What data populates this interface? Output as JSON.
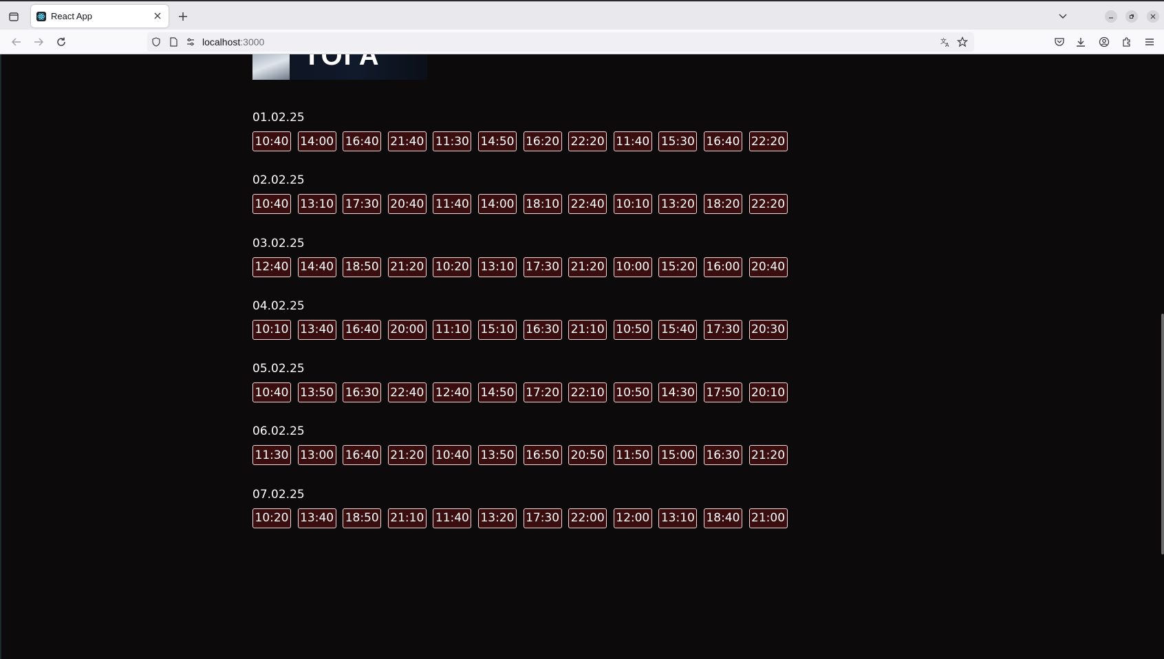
{
  "browser": {
    "tab_title": "React App",
    "url_host": "localhost",
    "url_port": ":3000"
  },
  "poster": {
    "title_fragment": "ТОГА"
  },
  "schedule": [
    {
      "date": "01.02.25",
      "times": [
        "10:40",
        "14:00",
        "16:40",
        "21:40",
        "11:30",
        "14:50",
        "16:20",
        "22:20",
        "11:40",
        "15:30",
        "16:40",
        "22:20"
      ]
    },
    {
      "date": "02.02.25",
      "times": [
        "10:40",
        "13:10",
        "17:30",
        "20:40",
        "11:40",
        "14:00",
        "18:10",
        "22:40",
        "10:10",
        "13:20",
        "18:20",
        "22:20"
      ]
    },
    {
      "date": "03.02.25",
      "times": [
        "12:40",
        "14:40",
        "18:50",
        "21:20",
        "10:20",
        "13:10",
        "17:30",
        "21:20",
        "10:00",
        "15:20",
        "16:00",
        "20:40"
      ]
    },
    {
      "date": "04.02.25",
      "times": [
        "10:10",
        "13:40",
        "16:40",
        "20:00",
        "11:10",
        "15:10",
        "16:30",
        "21:10",
        "10:50",
        "15:40",
        "17:30",
        "20:30"
      ]
    },
    {
      "date": "05.02.25",
      "times": [
        "10:40",
        "13:50",
        "16:30",
        "22:40",
        "12:40",
        "14:50",
        "17:20",
        "22:10",
        "10:50",
        "14:30",
        "17:50",
        "20:10"
      ]
    },
    {
      "date": "06.02.25",
      "times": [
        "11:30",
        "13:00",
        "16:40",
        "21:20",
        "10:40",
        "13:50",
        "16:50",
        "20:50",
        "11:50",
        "15:00",
        "16:30",
        "21:20"
      ]
    },
    {
      "date": "07.02.25",
      "times": [
        "10:20",
        "13:40",
        "18:50",
        "21:10",
        "11:40",
        "13:20",
        "17:30",
        "22:00",
        "12:00",
        "13:10",
        "18:40",
        "21:00"
      ]
    }
  ],
  "colors": {
    "page_background": "#0c0a0b",
    "time_button_background": "#3a0d0f",
    "time_button_border": "#f3d9d9",
    "text": "#ffffff"
  }
}
